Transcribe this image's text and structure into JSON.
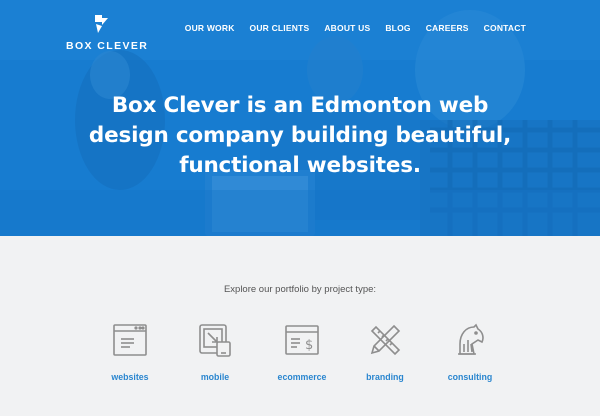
{
  "brand": {
    "name": "BOX CLEVER"
  },
  "nav": {
    "items": [
      {
        "label": "OUR WORK"
      },
      {
        "label": "OUR CLIENTS"
      },
      {
        "label": "ABOUT US"
      },
      {
        "label": "BLOG"
      },
      {
        "label": "CAREERS"
      },
      {
        "label": "CONTACT"
      }
    ]
  },
  "hero": {
    "headline_lines": [
      "Box Clever is an Edmonton web",
      "design company building beautiful,",
      "functional websites."
    ]
  },
  "portfolio": {
    "intro": "Explore our portfolio by project type:",
    "types": [
      {
        "label": "websites",
        "icon": "browser-window-icon"
      },
      {
        "label": "mobile",
        "icon": "mobile-devices-icon"
      },
      {
        "label": "ecommerce",
        "icon": "ecommerce-dollar-icon"
      },
      {
        "label": "branding",
        "icon": "pencil-ruler-icon"
      },
      {
        "label": "consulting",
        "icon": "chess-knight-icon"
      }
    ]
  },
  "colors": {
    "hero_blue": "#1b84d8",
    "link_blue": "#2a86cf",
    "page_bg": "#f1f2f3",
    "icon_gray": "#8e8e8e"
  }
}
